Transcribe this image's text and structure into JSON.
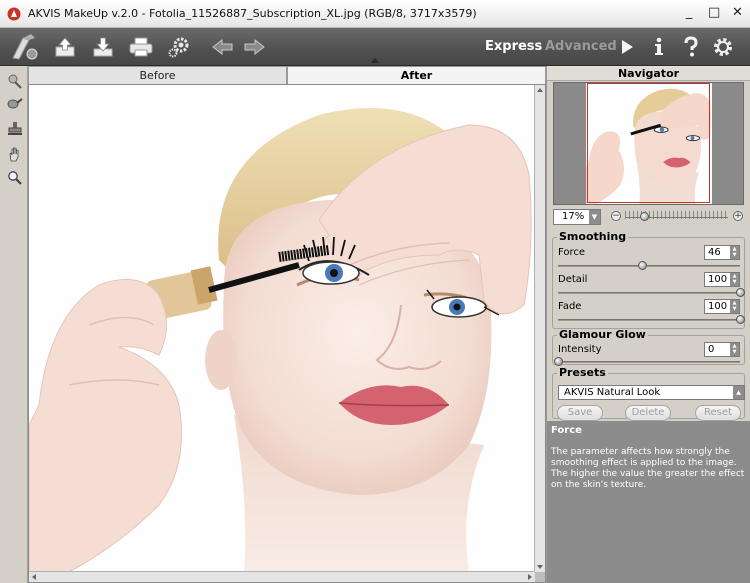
{
  "window": {
    "title": "AKVIS MakeUp v.2.0 - Fotolia_11526887_Subscription_XL.jpg (RGB/8, 3717x3579)",
    "minimize": "_",
    "maximize": "□",
    "close": "✕"
  },
  "toolbar": {
    "modes": {
      "express": "Express",
      "advanced": "Advanced"
    },
    "icons": [
      "logo-icon",
      "open-icon",
      "save-icon",
      "print-icon",
      "preferences-icon",
      "undo-icon",
      "redo-icon",
      "run-icon",
      "info-icon",
      "help-icon",
      "settings-icon"
    ]
  },
  "left_tools": [
    "retouch-brush-icon",
    "color-brush-icon",
    "stamp-icon",
    "hand-icon",
    "zoom-icon"
  ],
  "tabs": {
    "before": "Before",
    "after": "After"
  },
  "navigator": {
    "title": "Navigator",
    "zoom_value": "17%",
    "zoom_level": 0.18,
    "minus": "−",
    "plus": "+"
  },
  "smoothing": {
    "title": "Smoothing",
    "force": {
      "label": "Force",
      "value": "46",
      "level": 0.46
    },
    "detail": {
      "label": "Detail",
      "value": "100",
      "level": 1.0
    },
    "fade": {
      "label": "Fade",
      "value": "100",
      "level": 1.0
    }
  },
  "glamour": {
    "title": "Glamour Glow",
    "intensity": {
      "label": "Intensity",
      "value": "0",
      "level": 0.0
    }
  },
  "presets": {
    "title": "Presets",
    "selected": "AKVIS Natural Look",
    "save": "Save",
    "delete": "Delete",
    "reset": "Reset"
  },
  "hint": {
    "title": "Force",
    "text": "The parameter affects how strongly the smoothing effect is applied to the image. The higher the value the greater the effect on the skin's texture."
  },
  "colors": {
    "toolbar_bg": "#555555",
    "panel_bg": "#d4d0c8",
    "hint_bg": "#8c8c8c",
    "accent_red": "#c8342a"
  }
}
